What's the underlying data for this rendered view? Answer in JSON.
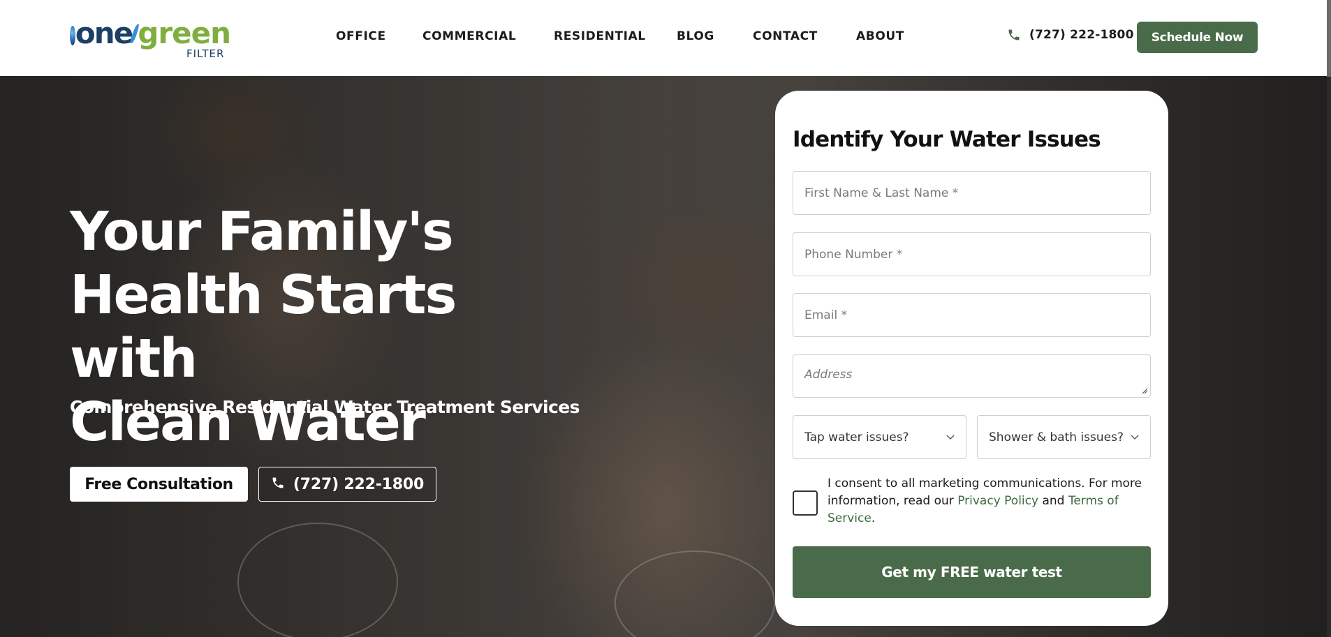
{
  "logo": {
    "part1": "one",
    "part2": "green",
    "tagline": "FILTER"
  },
  "nav": [
    {
      "label": "OFFICE"
    },
    {
      "label": "COMMERCIAL"
    },
    {
      "label": "RESIDENTIAL"
    },
    {
      "label": "BLOG"
    },
    {
      "label": "CONTACT"
    },
    {
      "label": "ABOUT"
    }
  ],
  "header": {
    "phone": "(727) 222-1800",
    "cta": "Schedule Now"
  },
  "hero": {
    "title_line1": "Your Family's",
    "title_line2": "Health Starts with",
    "title_line3": "Clean Water",
    "subtitle": "Comprehensive Residential Water Treatment Services",
    "consult_button": "Free Consultation",
    "phone_button": "(727) 222-1800"
  },
  "form": {
    "title": "Identify Your Water Issues",
    "name_placeholder": "First Name & Last Name *",
    "phone_placeholder": "Phone Number *",
    "email_placeholder": "Email *",
    "address_placeholder": "Address",
    "tap_select": "Tap water issues?",
    "shower_select": "Shower & bath issues?",
    "consent_text": "I consent to all marketing communications. For more information, read our ",
    "privacy_link": "Privacy Policy",
    "and_text": " and ",
    "terms_link": "Terms of Service",
    "period": ".",
    "submit": "Get my FREE water test"
  },
  "colors": {
    "brand_green": "#4a6b4a",
    "link_green": "#3d6b3d",
    "logo_green": "#7fae3f",
    "logo_blue": "#1d3f66"
  },
  "icons": [
    "phone-icon",
    "chevron-down-icon",
    "globe-icon",
    "water-drop-icon"
  ]
}
